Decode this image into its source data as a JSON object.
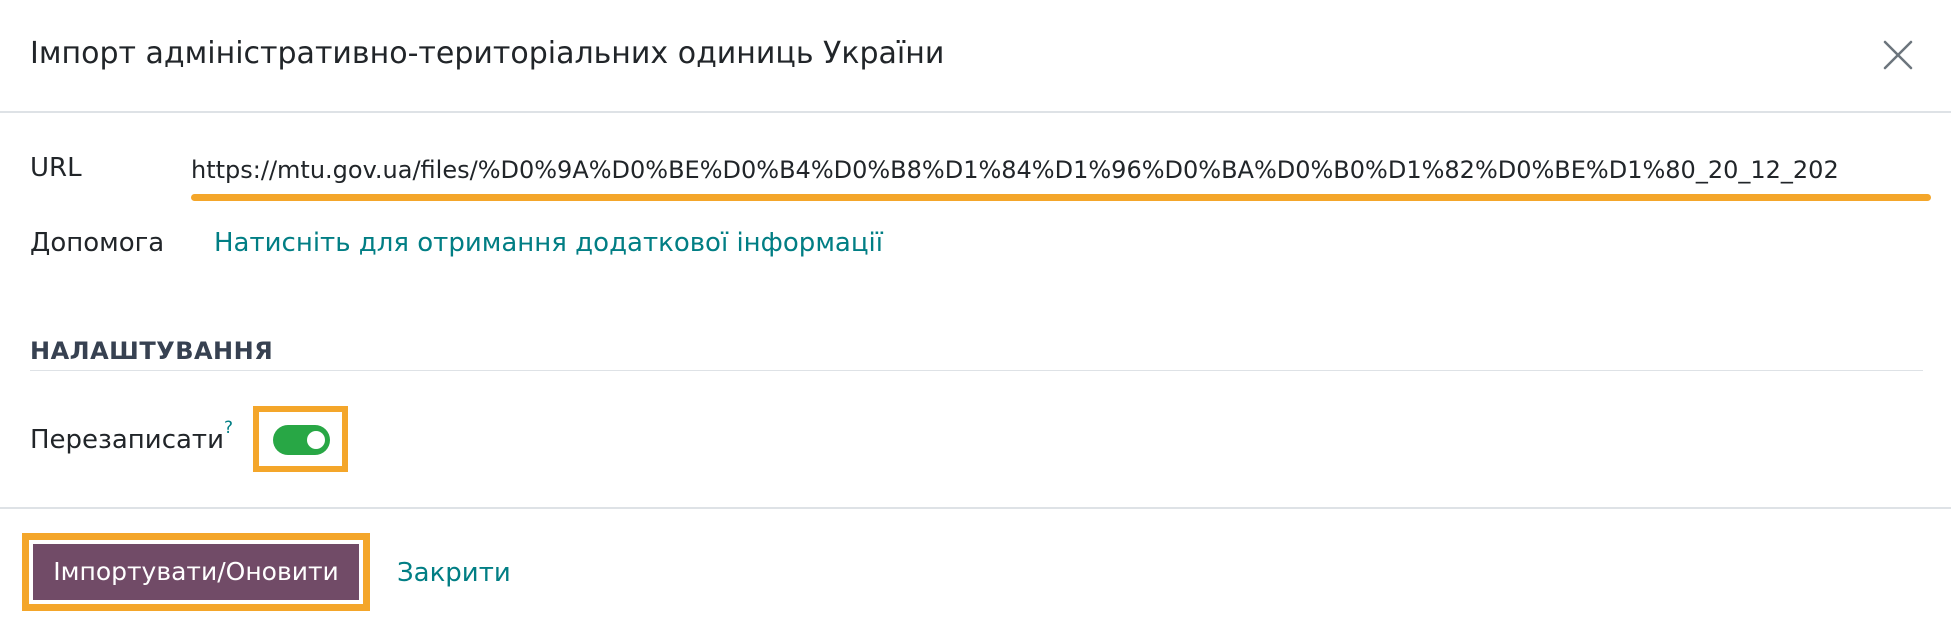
{
  "dialog": {
    "title": "Імпорт адміністративно-територіальних одиниць України"
  },
  "form": {
    "url_label": "URL",
    "url_value": "https://mtu.gov.ua/files/%D0%9A%D0%BE%D0%B4%D0%B8%D1%84%D1%96%D0%BA%D0%B0%D1%82%D0%BE%D1%80_20_12_202",
    "help_label": "Допомога",
    "help_link": "Натисніть для отримання додаткової інформації"
  },
  "settings": {
    "section_title": "НАЛАШТУВАННЯ",
    "overwrite_label": "Перезаписати",
    "overwrite_tooltip": "?",
    "overwrite_enabled": true
  },
  "footer": {
    "primary_label": "Імпортувати/Оновити",
    "secondary_label": "Закрити"
  },
  "icons": {
    "close": "close-icon"
  },
  "colors": {
    "primary": "#714b67",
    "link": "#017e84",
    "toggle_on": "#28a745",
    "highlight": "#f4a62a"
  }
}
